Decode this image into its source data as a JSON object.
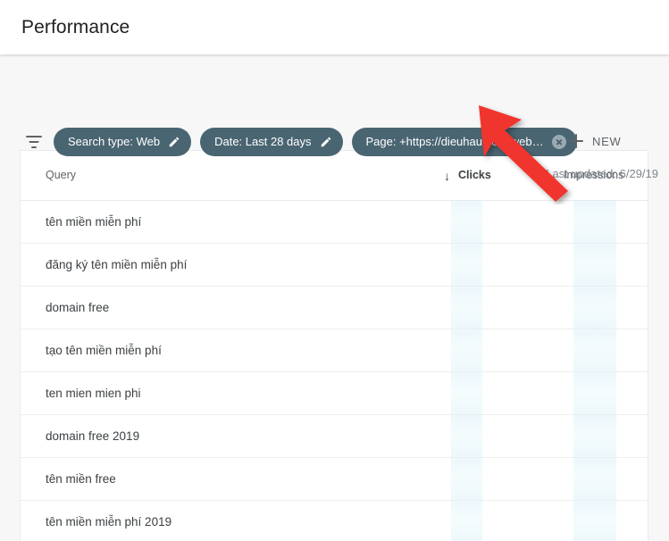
{
  "header": {
    "title": "Performance"
  },
  "toolbar": {
    "filter_icon": "filter-icon",
    "chips": [
      {
        "label": "Search type: Web",
        "action_icon": "pencil-icon"
      },
      {
        "label": "Date: Last 28 days",
        "action_icon": "pencil-icon"
      },
      {
        "label": "Page: +https://dieuhau.com/web…",
        "action_icon": "close-circle-icon"
      }
    ],
    "new_button": {
      "label": "NEW",
      "icon": "plus-icon"
    },
    "last_updated": "Last updated: 6/29/19"
  },
  "table": {
    "columns": [
      {
        "key": "query",
        "label": "Query",
        "sorted": false
      },
      {
        "key": "clicks",
        "label": "Clicks",
        "sorted": true,
        "sort_icon": "arrow-down-icon",
        "sort_direction": "desc"
      },
      {
        "key": "impressions",
        "label": "Impressions",
        "sorted": false
      }
    ],
    "rows": [
      {
        "query": "tên miền miễn phí",
        "clicks": "",
        "impressions": ""
      },
      {
        "query": "đăng ký tên miền miễn phí",
        "clicks": "",
        "impressions": ""
      },
      {
        "query": "domain free",
        "clicks": "",
        "impressions": ""
      },
      {
        "query": "tạo tên miền miễn phí",
        "clicks": "",
        "impressions": ""
      },
      {
        "query": "ten mien mien phi",
        "clicks": "",
        "impressions": ""
      },
      {
        "query": "domain free 2019",
        "clicks": "",
        "impressions": ""
      },
      {
        "query": "tên miền free",
        "clicks": "",
        "impressions": ""
      },
      {
        "query": "tên miền miễn phí 2019",
        "clicks": "",
        "impressions": ""
      }
    ]
  },
  "annotation": {
    "arrow_color": "#f0342e",
    "points_to": "page-filter-chip"
  },
  "colors": {
    "chip_background": "#4a6572",
    "chip_text": "#ffffff",
    "header_text": "#202124",
    "muted_text": "#5f6368",
    "row_text": "#3c4043",
    "toolbar_background": "#f7f7f7",
    "shimmer": "#eaf6fa",
    "annotation_red": "#f0342e"
  }
}
